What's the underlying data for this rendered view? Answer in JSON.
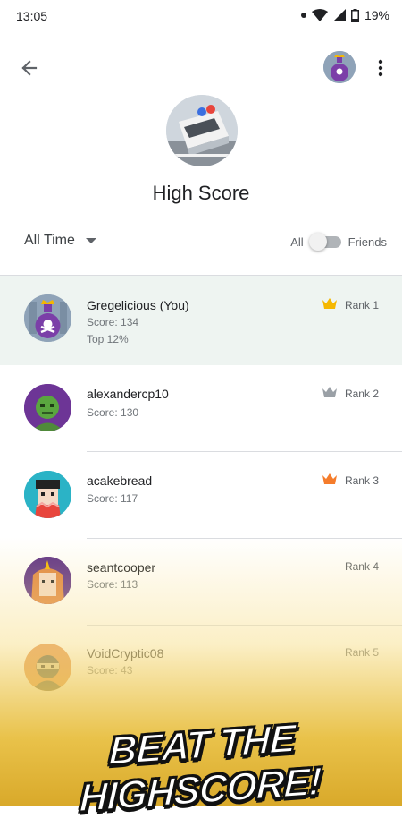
{
  "status_bar": {
    "time": "13:05",
    "battery": "19%",
    "icons": [
      "dot-icon",
      "wifi-icon",
      "signal-icon",
      "battery-icon"
    ]
  },
  "app_bar": {
    "icons": [
      "back-arrow-icon",
      "profile-avatar",
      "more-vert-icon"
    ]
  },
  "leaderboard": {
    "title": "High Score",
    "time_filter": "All Time",
    "toggle_left": "All",
    "toggle_right": "Friends"
  },
  "players": [
    {
      "name": "Gregelicious (You)",
      "score": "Score: 134",
      "extra": "Top 12%",
      "rank": "Rank 1",
      "crown": "gold",
      "crown_color": "#f5b700"
    },
    {
      "name": "alexandercp10",
      "score": "Score: 130",
      "rank": "Rank 2",
      "crown": "silver",
      "crown_color": "#9aa0a6"
    },
    {
      "name": "acakebread",
      "score": "Score: 117",
      "rank": "Rank 3",
      "crown": "bronze",
      "crown_color": "#f57c2b"
    },
    {
      "name": "seantcooper",
      "score": "Score: 113",
      "rank": "Rank 4"
    },
    {
      "name": "VoidCryptic08",
      "score": "Score: 43",
      "rank": "Rank 5"
    }
  ],
  "promo": {
    "text": "BEAT THE HIGHSCORE!"
  },
  "colors": {
    "highlight_row": "#eef4f1",
    "divider": "#dadce0",
    "promo_gold": "#e9c24a"
  }
}
